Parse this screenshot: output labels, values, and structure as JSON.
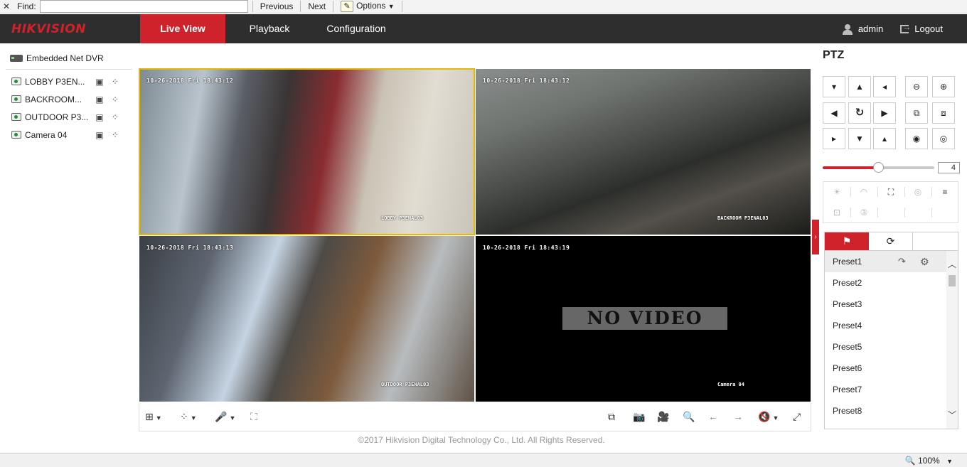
{
  "findbar": {
    "close": "✕",
    "label": "Find:",
    "value": "",
    "previous": "Previous",
    "next": "Next",
    "options": "Options"
  },
  "nav": {
    "brand": "HIKVISION",
    "tabs": [
      {
        "label": "Live View",
        "active": true
      },
      {
        "label": "Playback",
        "active": false
      },
      {
        "label": "Configuration",
        "active": false
      }
    ],
    "user": "admin",
    "logout": "Logout"
  },
  "sidebar": {
    "device": "Embedded Net DVR",
    "cameras": [
      {
        "name": "LOBBY P3EN..."
      },
      {
        "name": "BACKROOM..."
      },
      {
        "name": "OUTDOOR P3..."
      },
      {
        "name": "Camera 04"
      }
    ]
  },
  "video": {
    "tiles": [
      {
        "timestamp": "10-26-2018 Fri 18:43:12",
        "label": "LOBBY P3ENAL03",
        "selected": true
      },
      {
        "timestamp": "10-26-2018 Fri 18:43:12",
        "label": "BACKROOM P3ENAL03",
        "selected": false
      },
      {
        "timestamp": "10-26-2018 Fri 18:43:13",
        "label": "OUTDOOR P3ENAL03",
        "selected": false
      },
      {
        "timestamp": "10-26-2018 Fri 18:43:19",
        "label": "Camera 04",
        "no_video": "NO VIDEO",
        "selected": false
      }
    ]
  },
  "toolbar": {
    "left": [
      "layout-icon",
      "ptz-icon",
      "microphone-icon",
      "fullscreen-grid-icon"
    ],
    "right": [
      "capture-all-icon",
      "snapshot-icon",
      "record-icon",
      "zoom-in-icon",
      "prev-page-icon",
      "next-page-icon",
      "mute-icon",
      "fullscreen-icon"
    ]
  },
  "copyright": "©2017 Hikvision Digital Technology Co., Ltd. All Rights Reserved.",
  "ptz": {
    "title": "PTZ",
    "speed": "4",
    "speed_level": 0.5,
    "presets": [
      "Preset1",
      "Preset2",
      "Preset3",
      "Preset4",
      "Preset5",
      "Preset6",
      "Preset7",
      "Preset8"
    ]
  },
  "status": {
    "zoom": "100%"
  },
  "colors": {
    "accent": "#d0222b",
    "nav_bg": "#2e2e2e",
    "selected_tile": "#e6b800"
  }
}
